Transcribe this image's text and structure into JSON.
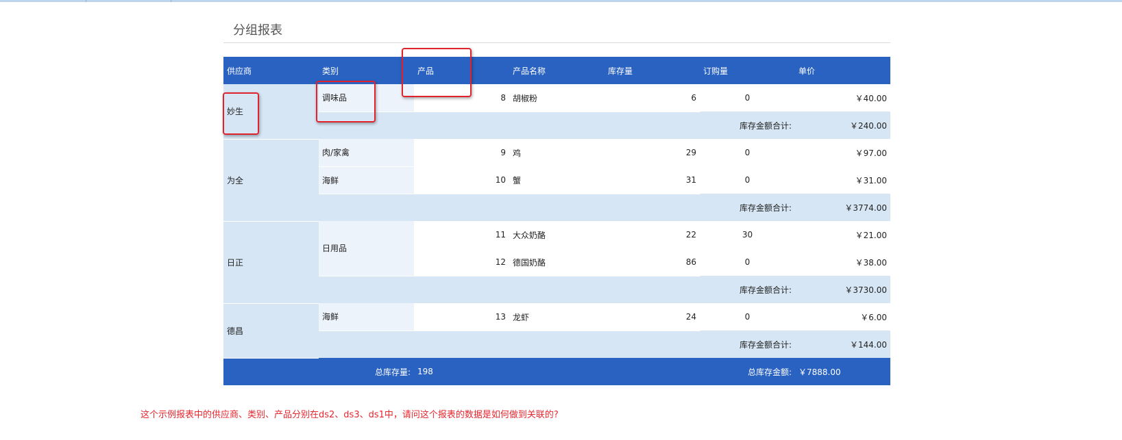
{
  "title": "分组报表",
  "headers": [
    "供应商",
    "类别",
    "产品",
    "产品名称",
    "库存量",
    "订购量",
    "单价"
  ],
  "groups": [
    {
      "supplier": "妙生",
      "categories": [
        {
          "name": "调味品",
          "products": [
            {
              "id": "8",
              "name": "胡椒粉",
              "stock": "6",
              "order": "0",
              "price": "￥40.00"
            }
          ]
        }
      ],
      "subtotal_label": "库存金额合计:",
      "subtotal_value": "￥240.00"
    },
    {
      "supplier": "为全",
      "categories": [
        {
          "name": "肉/家禽",
          "products": [
            {
              "id": "9",
              "name": "鸡",
              "stock": "29",
              "order": "0",
              "price": "￥97.00"
            }
          ]
        },
        {
          "name": "海鲜",
          "products": [
            {
              "id": "10",
              "name": "蟹",
              "stock": "31",
              "order": "0",
              "price": "￥31.00"
            }
          ]
        }
      ],
      "subtotal_label": "库存金额合计:",
      "subtotal_value": "￥3774.00"
    },
    {
      "supplier": "日正",
      "categories": [
        {
          "name": "日用品",
          "products": [
            {
              "id": "11",
              "name": "大众奶酪",
              "stock": "22",
              "order": "30",
              "price": "￥21.00"
            },
            {
              "id": "12",
              "name": "德国奶酪",
              "stock": "86",
              "order": "0",
              "price": "￥38.00"
            }
          ]
        }
      ],
      "subtotal_label": "库存金额合计:",
      "subtotal_value": "￥3730.00"
    },
    {
      "supplier": "德昌",
      "categories": [
        {
          "name": "海鲜",
          "products": [
            {
              "id": "13",
              "name": "龙虾",
              "stock": "24",
              "order": "0",
              "price": "￥6.00"
            }
          ]
        }
      ],
      "subtotal_label": "库存金额合计:",
      "subtotal_value": "￥144.00"
    }
  ],
  "totals": {
    "stock_label": "总库存量:",
    "stock_value": "198",
    "amount_label": "总库存金额:",
    "amount_value": "￥7888.00"
  },
  "question": "这个示例报表中的供应商、类别、产品分别在ds2、ds3、ds1中，请问这个报表的数据是如何做到关联的?",
  "colors": {
    "header": "#2a62c2",
    "group_fill": "#d6e6f4",
    "category_fill": "#edf3fa",
    "highlight": "#e0222c",
    "question": "#e8252d"
  }
}
